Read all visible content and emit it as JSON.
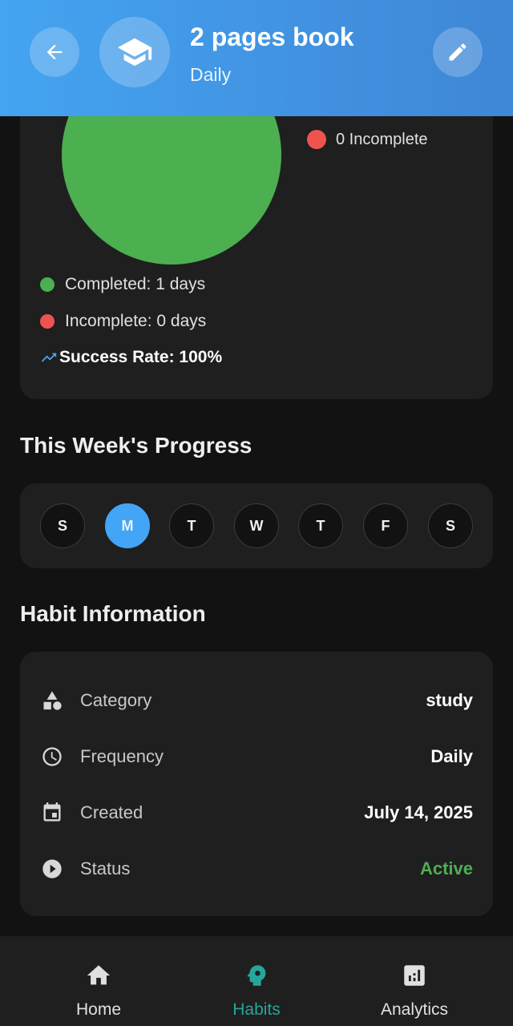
{
  "header": {
    "title": "2 pages book",
    "subtitle": "Daily",
    "back_icon": "arrow-left-icon",
    "habit_icon": "graduation-cap-icon",
    "edit_icon": "pencil-icon"
  },
  "summary": {
    "pie": {
      "completed": 1,
      "incomplete": 0,
      "colors": {
        "completed": "#4caf50",
        "incomplete": "#ef5350"
      }
    },
    "legend_incomplete": "0 Incomplete",
    "completed_text": "Completed: 1 days",
    "incomplete_text": "Incomplete: 0 days",
    "success_rate": "Success Rate: 100%"
  },
  "week": {
    "title": "This Week's Progress",
    "days": [
      {
        "label": "S",
        "active": false
      },
      {
        "label": "M",
        "active": true
      },
      {
        "label": "T",
        "active": false
      },
      {
        "label": "W",
        "active": false
      },
      {
        "label": "T",
        "active": false
      },
      {
        "label": "F",
        "active": false
      },
      {
        "label": "S",
        "active": false
      }
    ],
    "active_color": "#42a5f5"
  },
  "info": {
    "title": "Habit Information",
    "rows": [
      {
        "label": "Category",
        "value": "study",
        "icon": "category-shapes-icon"
      },
      {
        "label": "Frequency",
        "value": "Daily",
        "icon": "clock-icon"
      },
      {
        "label": "Created",
        "value": "July 14, 2025",
        "icon": "calendar-icon"
      },
      {
        "label": "Status",
        "value": "Active",
        "icon": "play-circle-icon",
        "value_color": "#4caf50"
      }
    ]
  },
  "nav": {
    "items": [
      {
        "label": "Home",
        "icon": "home-icon",
        "selected": false
      },
      {
        "label": "Habits",
        "icon": "head-gear-icon",
        "selected": true
      },
      {
        "label": "Analytics",
        "icon": "analytics-icon",
        "selected": false
      }
    ],
    "selected_color": "#26a69a"
  }
}
